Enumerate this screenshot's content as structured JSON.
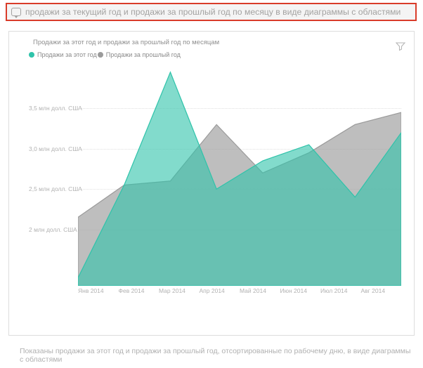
{
  "query_bar": {
    "segments": [
      {
        "text": "продажи за текущий год",
        "underlined": true
      },
      {
        "text": " и ",
        "underlined": false
      },
      {
        "text": "продажи за прошлый год",
        "underlined": true
      },
      {
        "text": " по ",
        "underlined": false
      },
      {
        "text": "месяцу",
        "underlined": true
      },
      {
        "text": " в виде ",
        "underlined": false
      },
      {
        "text": "диаграммы с областями",
        "underlined": true
      }
    ]
  },
  "chart_title": "Продажи за этот год и продажи за прошлый год по месяцам",
  "legend": [
    {
      "label": "Продажи за этот год",
      "color": "#2fc3aa"
    },
    {
      "label": "Продажи за прошлый год",
      "color": "#9b9b9b"
    }
  ],
  "caption": "Показаны продажи за этот год и продажи за прошлый год, отсортированные по рабочему дню, в виде диаграммы с областями",
  "y_ticks": [
    {
      "label": "3,5 млн долл. США",
      "value": 3.5
    },
    {
      "label": "3,0 млн долл. США",
      "value": 3.0
    },
    {
      "label": "2,5 млн долл. США",
      "value": 2.5
    },
    {
      "label": "2 млн долл. США",
      "value": 2.0
    }
  ],
  "x_ticks": [
    "Янв 2014",
    "Фев 2014",
    "Мар 2014",
    "Апр 2014",
    "Май 2014",
    "Июн 2014",
    "Июл 2014",
    "Авг 2014"
  ],
  "chart_data": {
    "type": "area",
    "title": "Продажи за этот год и продажи за прошлый год по месяцам",
    "xlabel": "",
    "ylabel": "",
    "ylim": [
      1.3,
      4.0
    ],
    "categories": [
      "Янв 2014",
      "Фев 2014",
      "Мар 2014",
      "Апр 2014",
      "Май 2014",
      "Июн 2014",
      "Июл 2014",
      "Авг 2014"
    ],
    "series": [
      {
        "name": "Продажи за этот год",
        "color": "#2fc3aa",
        "values": [
          1.4,
          2.55,
          3.95,
          2.5,
          2.85,
          3.05,
          2.4,
          3.2
        ]
      },
      {
        "name": "Продажи за прошлый год",
        "color": "#9b9b9b",
        "values": [
          2.15,
          2.55,
          2.6,
          3.3,
          2.7,
          2.95,
          3.3,
          3.45
        ]
      }
    ]
  },
  "colors": {
    "accent_teal": "#2fc3aa",
    "accent_gray": "#9b9b9b"
  }
}
